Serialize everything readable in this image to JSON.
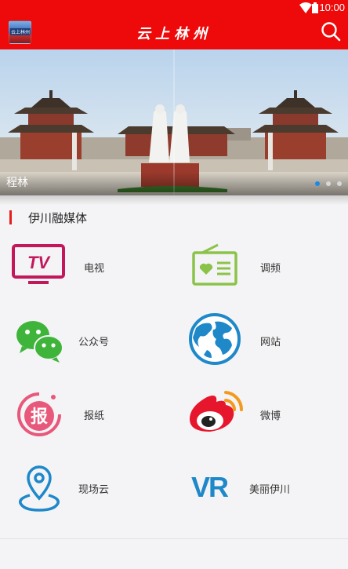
{
  "status_bar": {
    "time": "10:00"
  },
  "app_bar": {
    "logo_text": "云上林州",
    "title": "云上林州"
  },
  "banner": {
    "caption": "程林",
    "slide_count": 3,
    "active_slide": 1
  },
  "section": {
    "title": "伊川融媒体"
  },
  "grid": [
    {
      "label": "电视",
      "icon": "tv-icon"
    },
    {
      "label": "调频",
      "icon": "radio-icon"
    },
    {
      "label": "公众号",
      "icon": "wechat-icon"
    },
    {
      "label": "网站",
      "icon": "globe-icon"
    },
    {
      "label": "报纸",
      "icon": "newspaper-icon",
      "icon_text": "报"
    },
    {
      "label": "微博",
      "icon": "weibo-icon"
    },
    {
      "label": "现场云",
      "icon": "location-icon"
    },
    {
      "label": "美丽伊川",
      "icon": "vr-icon",
      "icon_text": "VR"
    }
  ],
  "colors": {
    "brand_red": "#ee0a0a",
    "accent_blue": "#1e88e5",
    "tv_magenta": "#c2185b",
    "radio_green": "#8bc34a",
    "wechat_green": "#3fb43a",
    "globe_blue": "#1e88c9",
    "weibo_red": "#e6162d"
  }
}
